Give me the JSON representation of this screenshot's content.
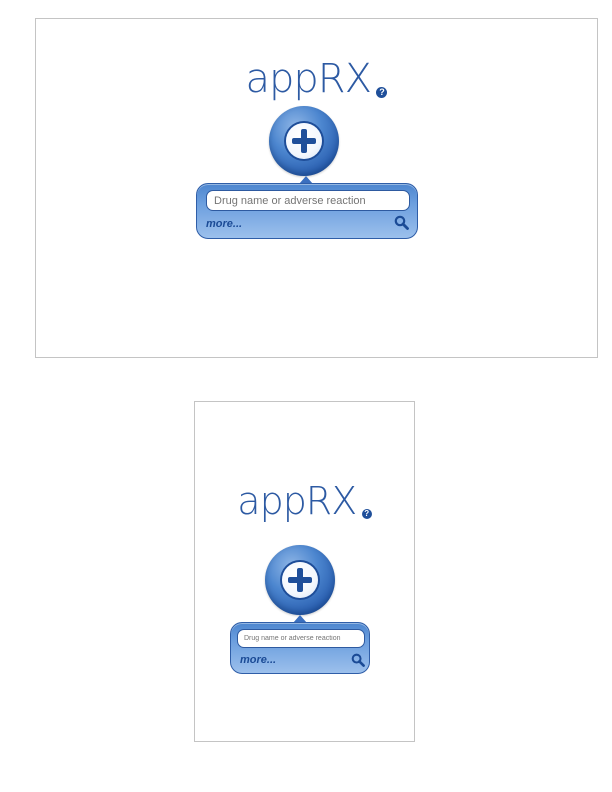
{
  "app": {
    "logo_text": "appRX",
    "help_glyph": "?"
  },
  "search": {
    "placeholder": "Drug name or adverse reaction",
    "more_label": "more..."
  },
  "icons": {
    "plus": "plus-icon",
    "search": "search-icon",
    "help": "help-icon"
  },
  "colors": {
    "brand": "#2d5aa3",
    "accent_dark": "#1f4f9a",
    "panel_light": "#9cc0ec"
  },
  "frames": [
    {
      "label": "landscape"
    },
    {
      "label": "portrait"
    }
  ]
}
